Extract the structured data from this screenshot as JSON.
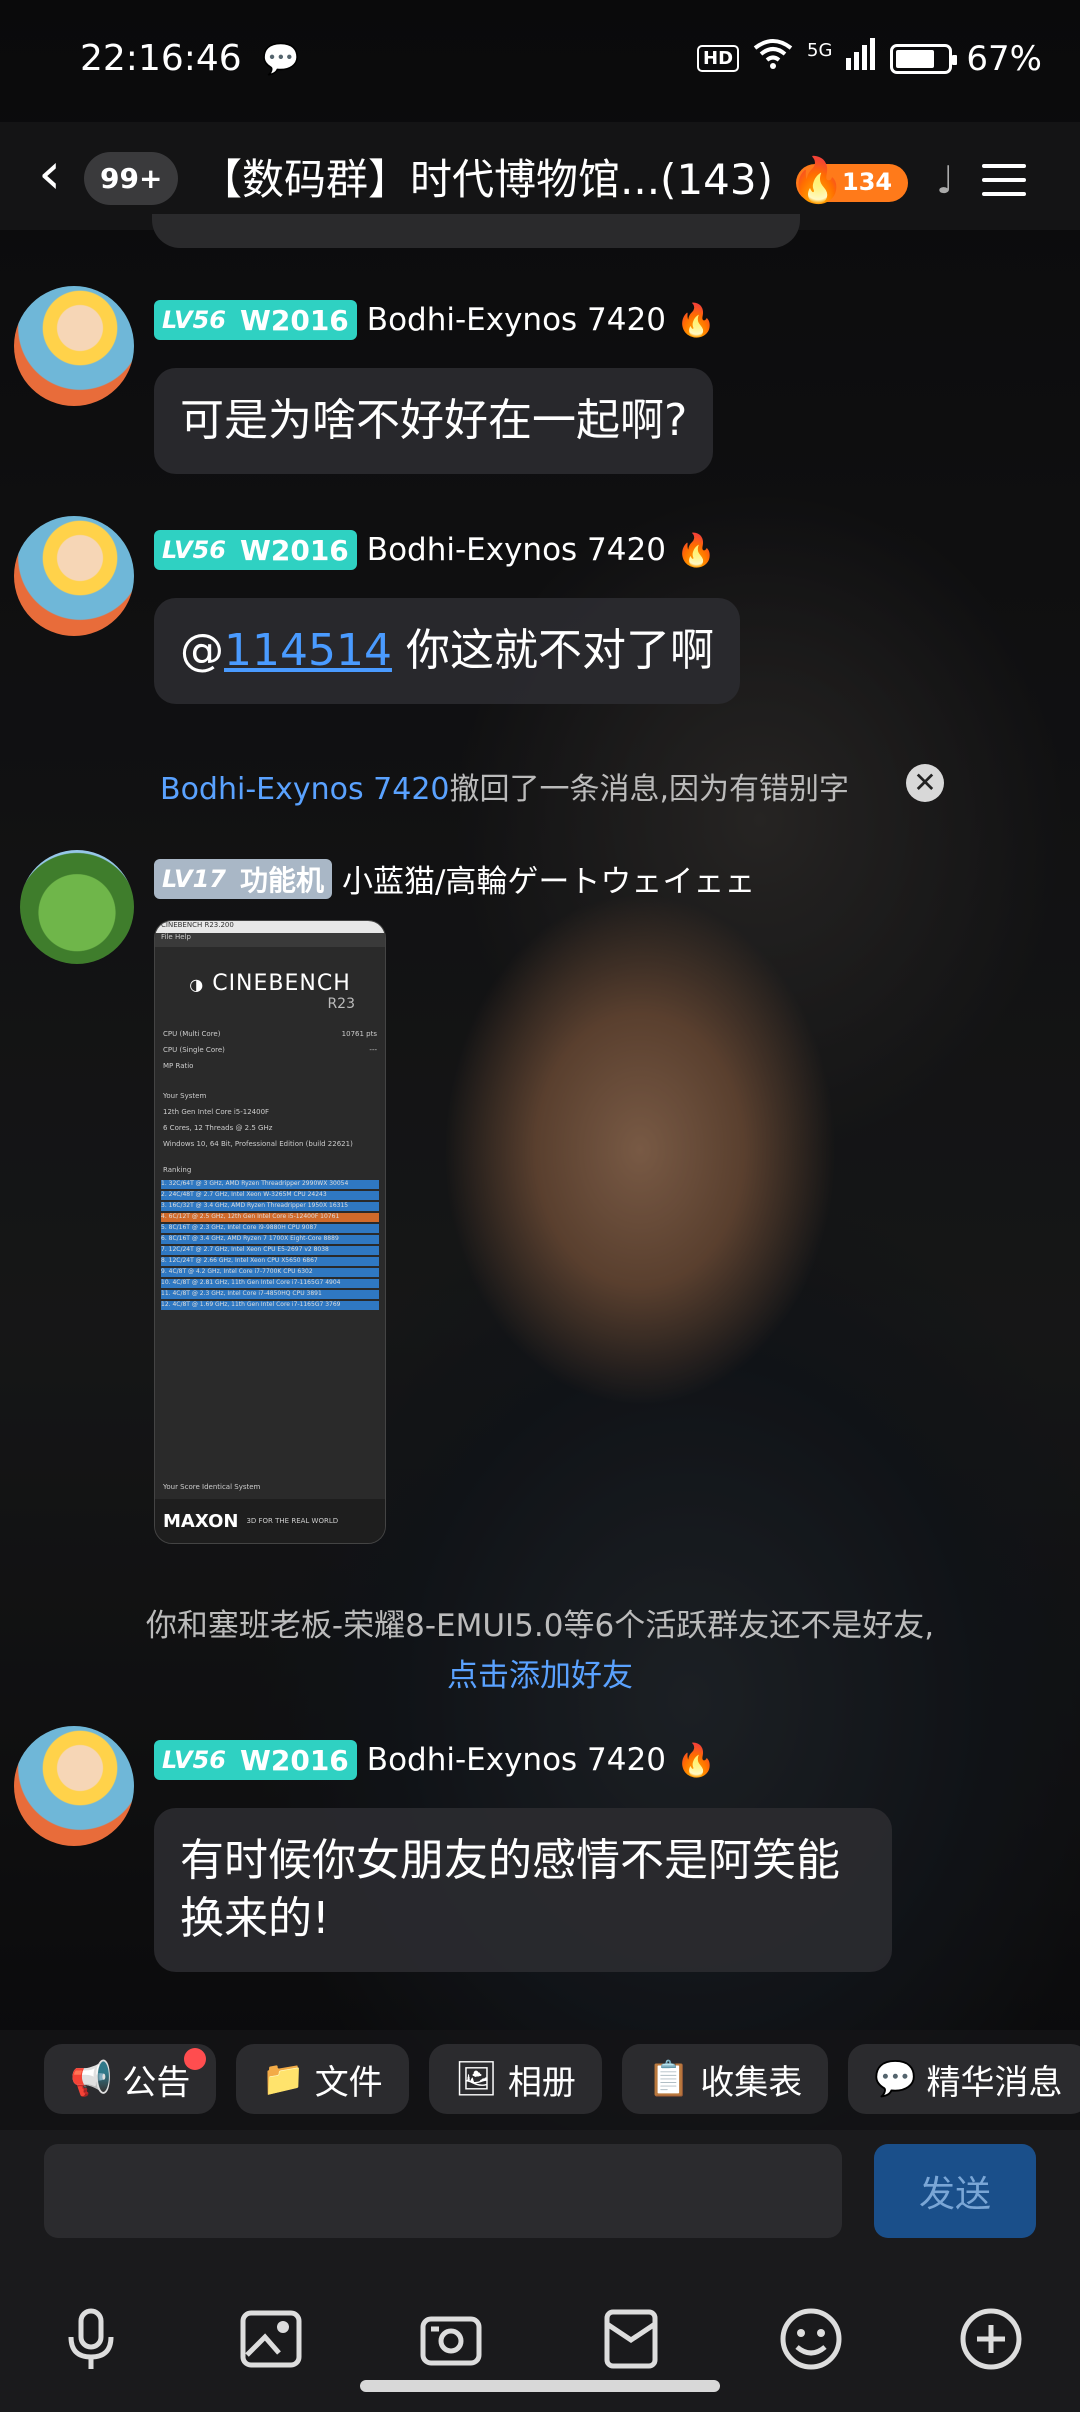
{
  "status_bar": {
    "time": "22:16:46",
    "battery": "67%",
    "network": "5G",
    "hd": "HD"
  },
  "header": {
    "unread_count": "99+",
    "title": "【数码群】时代博物馆...(143)",
    "fire_count": "134"
  },
  "messages": [
    {
      "level": "LV56",
      "badge": "W2016",
      "sender": "Bodhi-Exynos 7420",
      "text": "可是为啥不好好在一起啊?"
    },
    {
      "level": "LV56",
      "badge": "W2016",
      "sender": "Bodhi-Exynos 7420",
      "mention_prefix": "@",
      "mention": "114514",
      "text": " 你这就不对了啊"
    }
  ],
  "recall_notice": {
    "who": "Bodhi-Exynos 7420",
    "text": "撤回了一条消息,因为有错别字"
  },
  "image_message": {
    "level": "LV17",
    "badge": "功能机",
    "sender": "小蓝猫/高輪ゲートウェイェェ",
    "cinebench": {
      "window_title": "CINEBENCH R23.200",
      "menu": "File  Help",
      "logo": "CINEBENCH",
      "version": "R23",
      "cpu_multi_label": "CPU (Multi Core)",
      "cpu_multi_value": "10761 pts",
      "cpu_single_label": "CPU (Single Core)",
      "cpu_single_value": "---",
      "mp_ratio": "MP Ratio",
      "your_system": "Your System",
      "processor": "12th Gen Intel Core i5-12400F",
      "cores": "6 Cores, 12 Threads @ 2.5 GHz",
      "os": "Windows 10, 64 Bit, Professional Edition (build 22621)",
      "ranking": "Ranking",
      "ranks": [
        "1. 32C/64T @ 3 GHz, AMD Ryzen Threadripper 2990WX  30054",
        "2. 24C/48T @ 2.7 GHz, Intel Xeon W-3265M CPU  24243",
        "3. 16C/32T @ 3.4 GHz, AMD Ryzen Threadripper 1950X  16315",
        "4. 6C/12T @ 2.5 GHz, 12th Gen Intel Core i5-12400F  10761",
        "5. 8C/16T @ 2.3 GHz, Intel Core i9-9880H CPU  9087",
        "6. 8C/16T @ 3.4 GHz, AMD Ryzen 7 1700X Eight-Core  8889",
        "7. 12C/24T @ 2.7 GHz, Intel Xeon CPU E5-2697 v2  8038",
        "8. 12C/24T @ 2.66 GHz, Intel Xeon CPU X5650  6867",
        "9. 4C/8T @ 4.2 GHz, Intel Core i7-7700K CPU  6302",
        "10. 4C/8T @ 2.81 GHz, 11th Gen Intel Core i7-1165G7  4904",
        "11. 4C/8T @ 2.3 GHz, Intel Core i7-4850HQ CPU  3891",
        "12. 4C/8T @ 1.69 GHz, 11th Gen Intel Core i7-1165G7  3769"
      ],
      "legend": "Your Score   Identical System",
      "footer_brand": "MAXON",
      "footer_tag": "3D FOR THE REAL WORLD"
    }
  },
  "friend_suggestion": {
    "text": "你和塞班老板-荣耀8-EMUI5.0等6个活跃群友还不是好友,",
    "link": "点击添加好友"
  },
  "last_message": {
    "level": "LV56",
    "badge": "W2016",
    "sender": "Bodhi-Exynos 7420",
    "line1": "有时候你女朋友的感情不是阿笑能",
    "line2": "换来的!"
  },
  "chips": [
    {
      "icon": "announcement-icon",
      "label": "公告"
    },
    {
      "icon": "folder-icon",
      "label": "文件"
    },
    {
      "icon": "album-icon",
      "label": "相册"
    },
    {
      "icon": "clipboard-icon",
      "label": "收集表"
    },
    {
      "icon": "essence-icon",
      "label": "精华消息"
    }
  ],
  "input": {
    "placeholder": "",
    "send_label": "发送"
  },
  "colors": {
    "accent": "#4a9bff",
    "level_teal": "#2fd1c2",
    "fire": "#ff7a1a"
  }
}
